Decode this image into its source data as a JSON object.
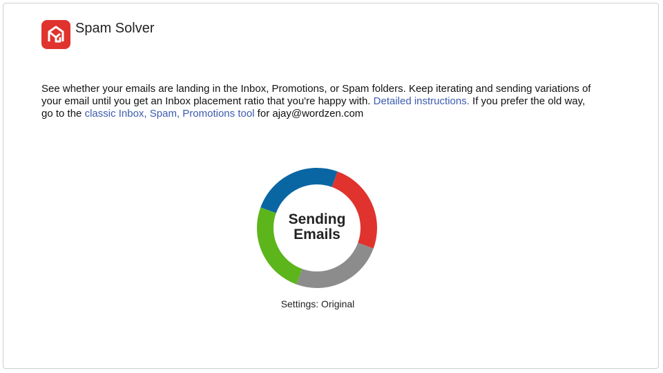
{
  "app": {
    "title": "Spam Solver",
    "logo_icon": "spam-solver-logo-icon",
    "brand_color": "#e0332e"
  },
  "description": {
    "text_1": "See whether your emails are landing in the Inbox, Promotions, or Spam folders. Keep iterating and sending variations of your email until you get an Inbox placement ratio that you're happy with. ",
    "link_1": "Detailed instructions.",
    "text_2": " If you prefer the old way, go to the ",
    "link_2": "classic Inbox, Spam, Promotions tool",
    "text_3": " for ajay@wordzen.com",
    "link_color": "#3c5bb0"
  },
  "progress": {
    "label_line_1": "Sending",
    "label_line_2": "Emails",
    "segment_colors": [
      "#0a66a3",
      "#e0332e",
      "#8c8c8c",
      "#5db51c"
    ],
    "settings_text": "Settings: Original"
  }
}
